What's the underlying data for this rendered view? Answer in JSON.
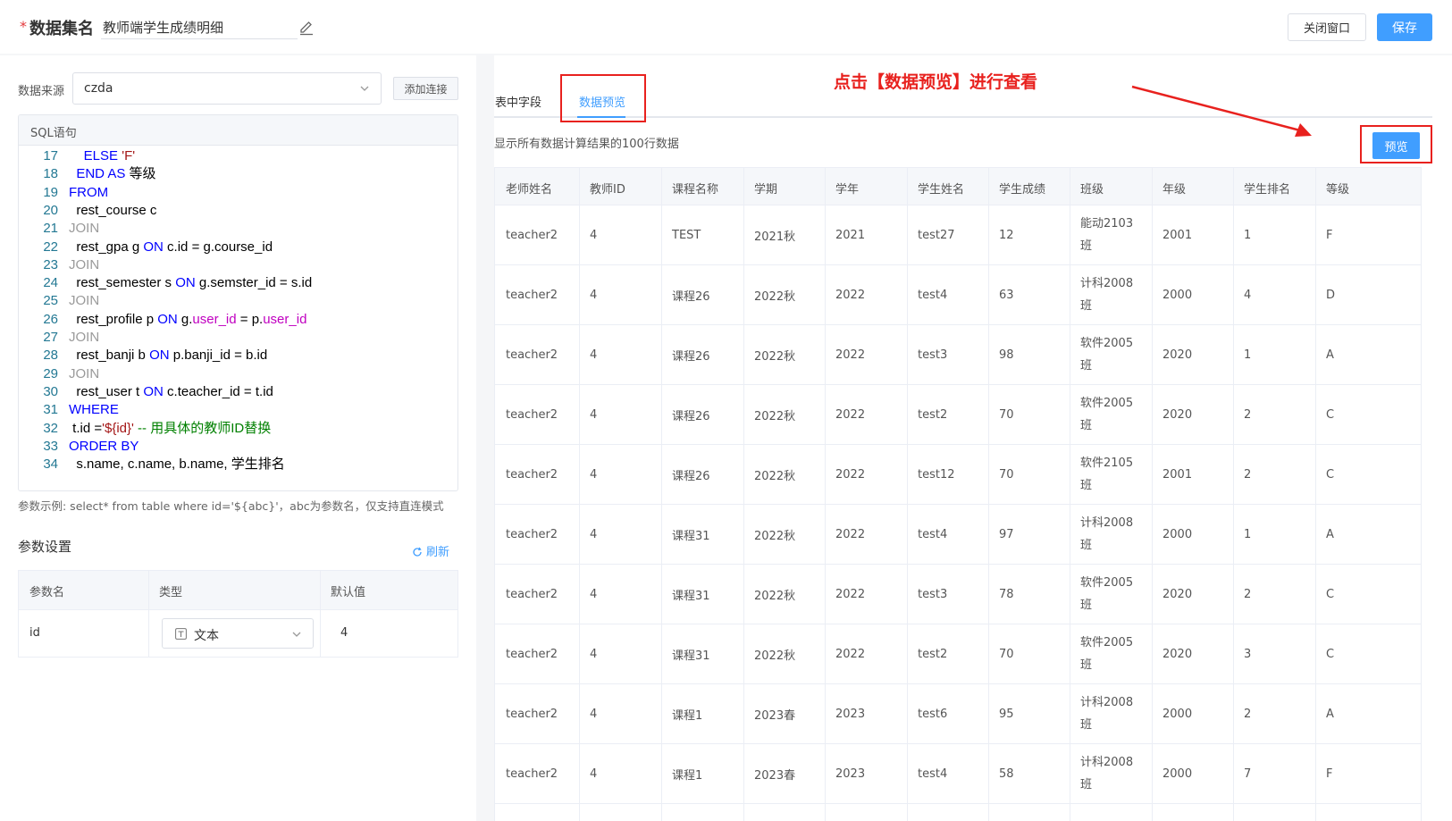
{
  "header": {
    "required_mark": "*",
    "dataset_label": "数据集名",
    "dataset_name": "教师端学生成绩明细",
    "close_label": "关闭窗口",
    "save_label": "保存"
  },
  "left": {
    "source_label": "数据来源",
    "source_value": "czda",
    "add_connection_label": "添加连接",
    "sql_header": "SQL语句",
    "hint": "参数示例: select* from table where id='${abc}'，abc为参数名，仅支持直连模式",
    "param_title": "参数设置",
    "refresh_label": "刷新",
    "param_columns": [
      "参数名",
      "类型",
      "默认值"
    ],
    "param_row": {
      "name": "id",
      "type": "文本",
      "default": "4"
    }
  },
  "code_lines": [
    {
      "n": "17",
      "segs": [
        [
          "",
          "    "
        ],
        [
          "kw",
          "ELSE "
        ],
        [
          "str",
          "'F'"
        ]
      ]
    },
    {
      "n": "18",
      "segs": [
        [
          "",
          "  "
        ],
        [
          "kw",
          "END AS"
        ],
        [
          "",
          " 等级"
        ]
      ]
    },
    {
      "n": "19",
      "segs": [
        [
          "kw",
          "FROM"
        ]
      ]
    },
    {
      "n": "20",
      "segs": [
        [
          "",
          "  rest_course c"
        ]
      ]
    },
    {
      "n": "21",
      "segs": [
        [
          "kwg",
          "JOIN"
        ]
      ]
    },
    {
      "n": "22",
      "segs": [
        [
          "",
          "  rest_gpa g "
        ],
        [
          "kw",
          "ON"
        ],
        [
          "",
          " c.id = g.course_id"
        ]
      ]
    },
    {
      "n": "23",
      "segs": [
        [
          "kwg",
          "JOIN"
        ]
      ]
    },
    {
      "n": "24",
      "segs": [
        [
          "",
          "  rest_semester s "
        ],
        [
          "kw",
          "ON"
        ],
        [
          "",
          " g.semster_id = s.id"
        ]
      ]
    },
    {
      "n": "25",
      "segs": [
        [
          "kwg",
          "JOIN"
        ]
      ]
    },
    {
      "n": "26",
      "segs": [
        [
          "",
          "  rest_profile p "
        ],
        [
          "kw",
          "ON"
        ],
        [
          "",
          " g."
        ],
        [
          "mag",
          "user_id"
        ],
        [
          "",
          " = p."
        ],
        [
          "mag",
          "user_id"
        ]
      ]
    },
    {
      "n": "27",
      "segs": [
        [
          "kwg",
          "JOIN"
        ]
      ]
    },
    {
      "n": "28",
      "segs": [
        [
          "",
          "  rest_banji b "
        ],
        [
          "kw",
          "ON"
        ],
        [
          "",
          " p.banji_id = b.id"
        ]
      ]
    },
    {
      "n": "29",
      "segs": [
        [
          "kwg",
          "JOIN"
        ]
      ]
    },
    {
      "n": "30",
      "segs": [
        [
          "",
          "  rest_user t "
        ],
        [
          "kw",
          "ON"
        ],
        [
          "",
          " c.teacher_id = t.id"
        ]
      ]
    },
    {
      "n": "31",
      "segs": [
        [
          "kw",
          "WHERE"
        ]
      ]
    },
    {
      "n": "32",
      "segs": [
        [
          "",
          " t.id ="
        ],
        [
          "str",
          "'${id}'"
        ],
        [
          "cmt",
          " -- 用具体的教师ID替换"
        ]
      ]
    },
    {
      "n": "33",
      "segs": [
        [
          "kw",
          "ORDER BY"
        ]
      ]
    },
    {
      "n": "34",
      "segs": [
        [
          "",
          "  s.name, c.name, b.name, 学生排名"
        ]
      ]
    }
  ],
  "right": {
    "tab_fields": "表中字段",
    "tab_preview": "数据预览",
    "annotation": "点击【数据预览】进行查看",
    "description": "显示所有数据计算结果的100行数据",
    "preview_label": "预览",
    "columns": [
      "老师姓名",
      "教师ID",
      "课程名称",
      "学期",
      "学年",
      "学生姓名",
      "学生成绩",
      "班级",
      "年级",
      "学生排名",
      "等级"
    ],
    "rows": [
      [
        "teacher2",
        "4",
        "TEST",
        "2021秋",
        "2021",
        "test27",
        "12",
        "能动2103班",
        "2001",
        "1",
        "F"
      ],
      [
        "teacher2",
        "4",
        "课程26",
        "2022秋",
        "2022",
        "test4",
        "63",
        "计科2008班",
        "2000",
        "4",
        "D"
      ],
      [
        "teacher2",
        "4",
        "课程26",
        "2022秋",
        "2022",
        "test3",
        "98",
        "软件2005班",
        "2020",
        "1",
        "A"
      ],
      [
        "teacher2",
        "4",
        "课程26",
        "2022秋",
        "2022",
        "test2",
        "70",
        "软件2005班",
        "2020",
        "2",
        "C"
      ],
      [
        "teacher2",
        "4",
        "课程26",
        "2022秋",
        "2022",
        "test12",
        "70",
        "软件2105班",
        "2001",
        "2",
        "C"
      ],
      [
        "teacher2",
        "4",
        "课程31",
        "2022秋",
        "2022",
        "test4",
        "97",
        "计科2008班",
        "2000",
        "1",
        "A"
      ],
      [
        "teacher2",
        "4",
        "课程31",
        "2022秋",
        "2022",
        "test3",
        "78",
        "软件2005班",
        "2020",
        "2",
        "C"
      ],
      [
        "teacher2",
        "4",
        "课程31",
        "2022秋",
        "2022",
        "test2",
        "70",
        "软件2005班",
        "2020",
        "3",
        "C"
      ],
      [
        "teacher2",
        "4",
        "课程1",
        "2023春",
        "2023",
        "test6",
        "95",
        "计科2008班",
        "2000",
        "2",
        "A"
      ],
      [
        "teacher2",
        "4",
        "课程1",
        "2023春",
        "2023",
        "test4",
        "58",
        "计科2008班",
        "2000",
        "7",
        "F"
      ]
    ]
  },
  "colors": {
    "primary": "#409eff",
    "annotation_red": "#e8211e"
  }
}
